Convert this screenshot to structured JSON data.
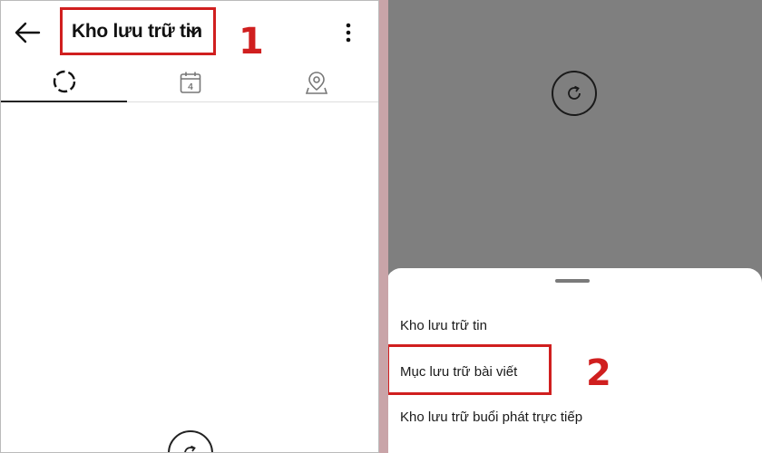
{
  "left_panel": {
    "title": "Kho lưu trữ tin",
    "step_number": "1",
    "tabs": [
      {
        "name": "stories",
        "icon": "dashed-circle-icon",
        "active": true
      },
      {
        "name": "calendar",
        "icon": "calendar-icon",
        "date": "4",
        "active": false
      },
      {
        "name": "map",
        "icon": "map-pin-icon",
        "active": false
      }
    ]
  },
  "right_panel": {
    "menu_items": [
      {
        "label": "Kho lưu trữ tin"
      },
      {
        "label": "Mục lưu trữ bài viết"
      },
      {
        "label": "Kho lưu trữ buổi phát trực tiếp"
      }
    ],
    "step_number": "2"
  },
  "colors": {
    "highlight": "#d01f1f",
    "overlay": "#7f7f7f",
    "divider": "#c9a4a8"
  }
}
